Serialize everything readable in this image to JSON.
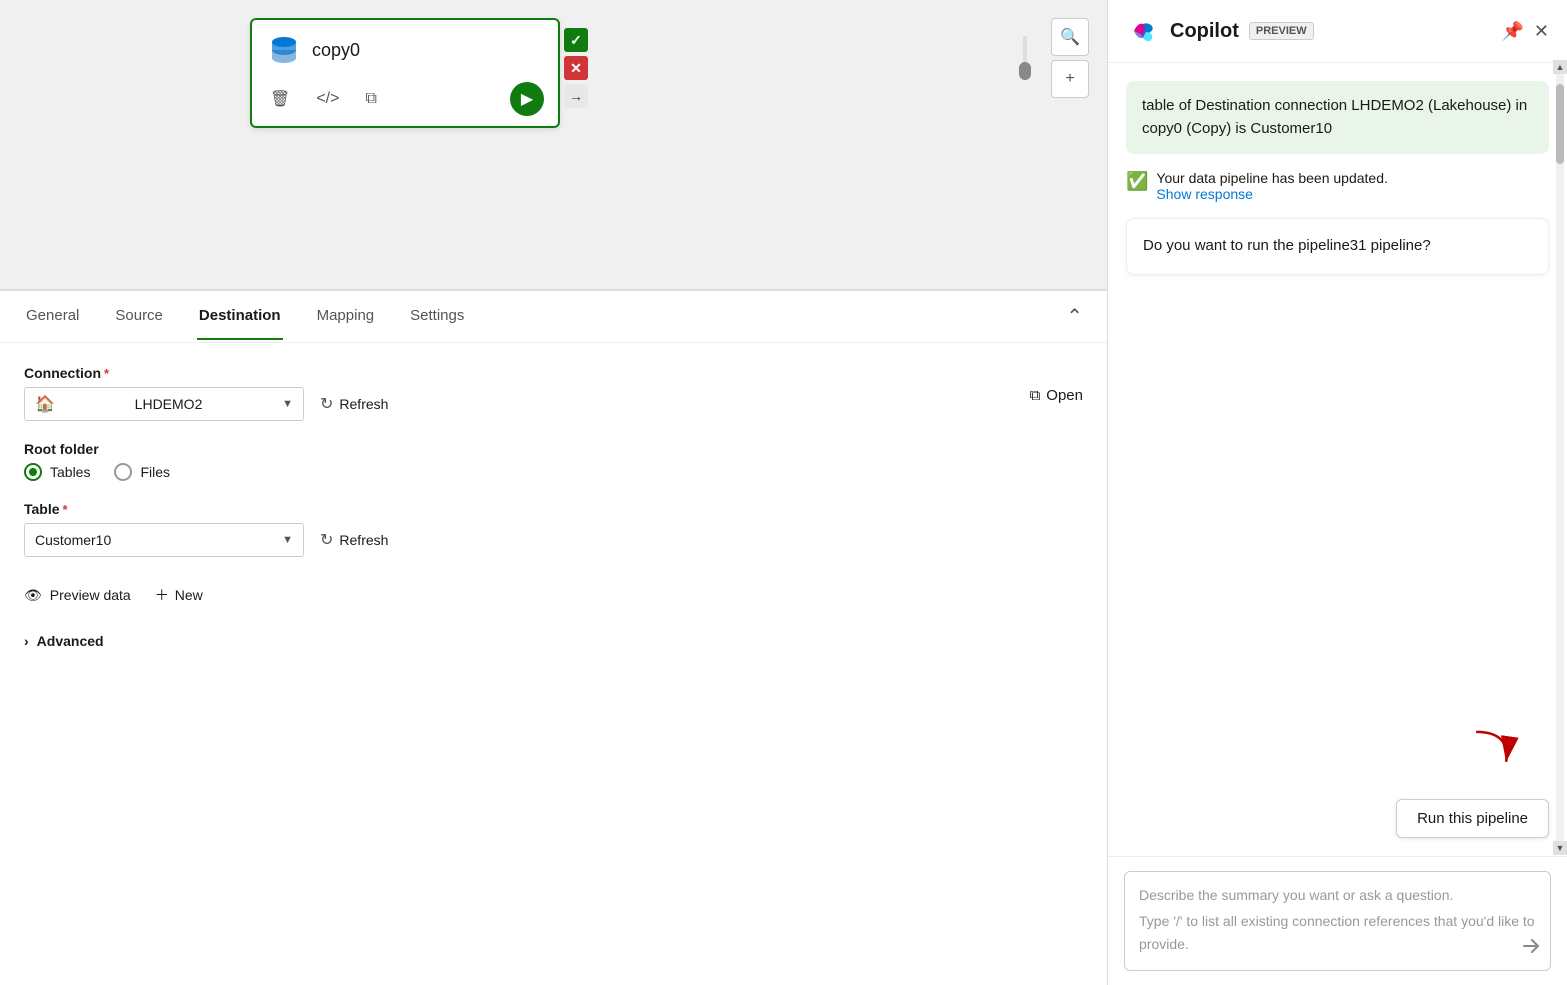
{
  "canvas": {
    "node": {
      "title": "copy0"
    }
  },
  "tabs": {
    "items": [
      {
        "id": "general",
        "label": "General"
      },
      {
        "id": "source",
        "label": "Source"
      },
      {
        "id": "destination",
        "label": "Destination",
        "active": true
      },
      {
        "id": "mapping",
        "label": "Mapping"
      },
      {
        "id": "settings",
        "label": "Settings"
      }
    ]
  },
  "destination": {
    "connection_label": "Connection",
    "connection_value": "LHDEMO2",
    "open_label": "Open",
    "refresh_label": "Refresh",
    "root_folder_label": "Root folder",
    "tables_label": "Tables",
    "files_label": "Files",
    "table_label": "Table",
    "table_value": "Customer10",
    "preview_data_label": "Preview data",
    "new_label": "New",
    "advanced_label": "Advanced"
  },
  "copilot": {
    "title": "Copilot",
    "preview_badge": "PREVIEW",
    "message1": "table of Destination connection LHDEMO2 (Lakehouse) in copy0 (Copy) is Customer10",
    "status_text": "Your data pipeline has been updated.",
    "show_response": "Show response",
    "question_text": "Do you want to run the pipeline31 pipeline?",
    "run_btn": "Run this pipeline",
    "input_placeholder_line1": "Describe the summary you want or ask a question.",
    "input_placeholder_line2": "Type '/' to list all existing connection references that you'd like to provide."
  }
}
